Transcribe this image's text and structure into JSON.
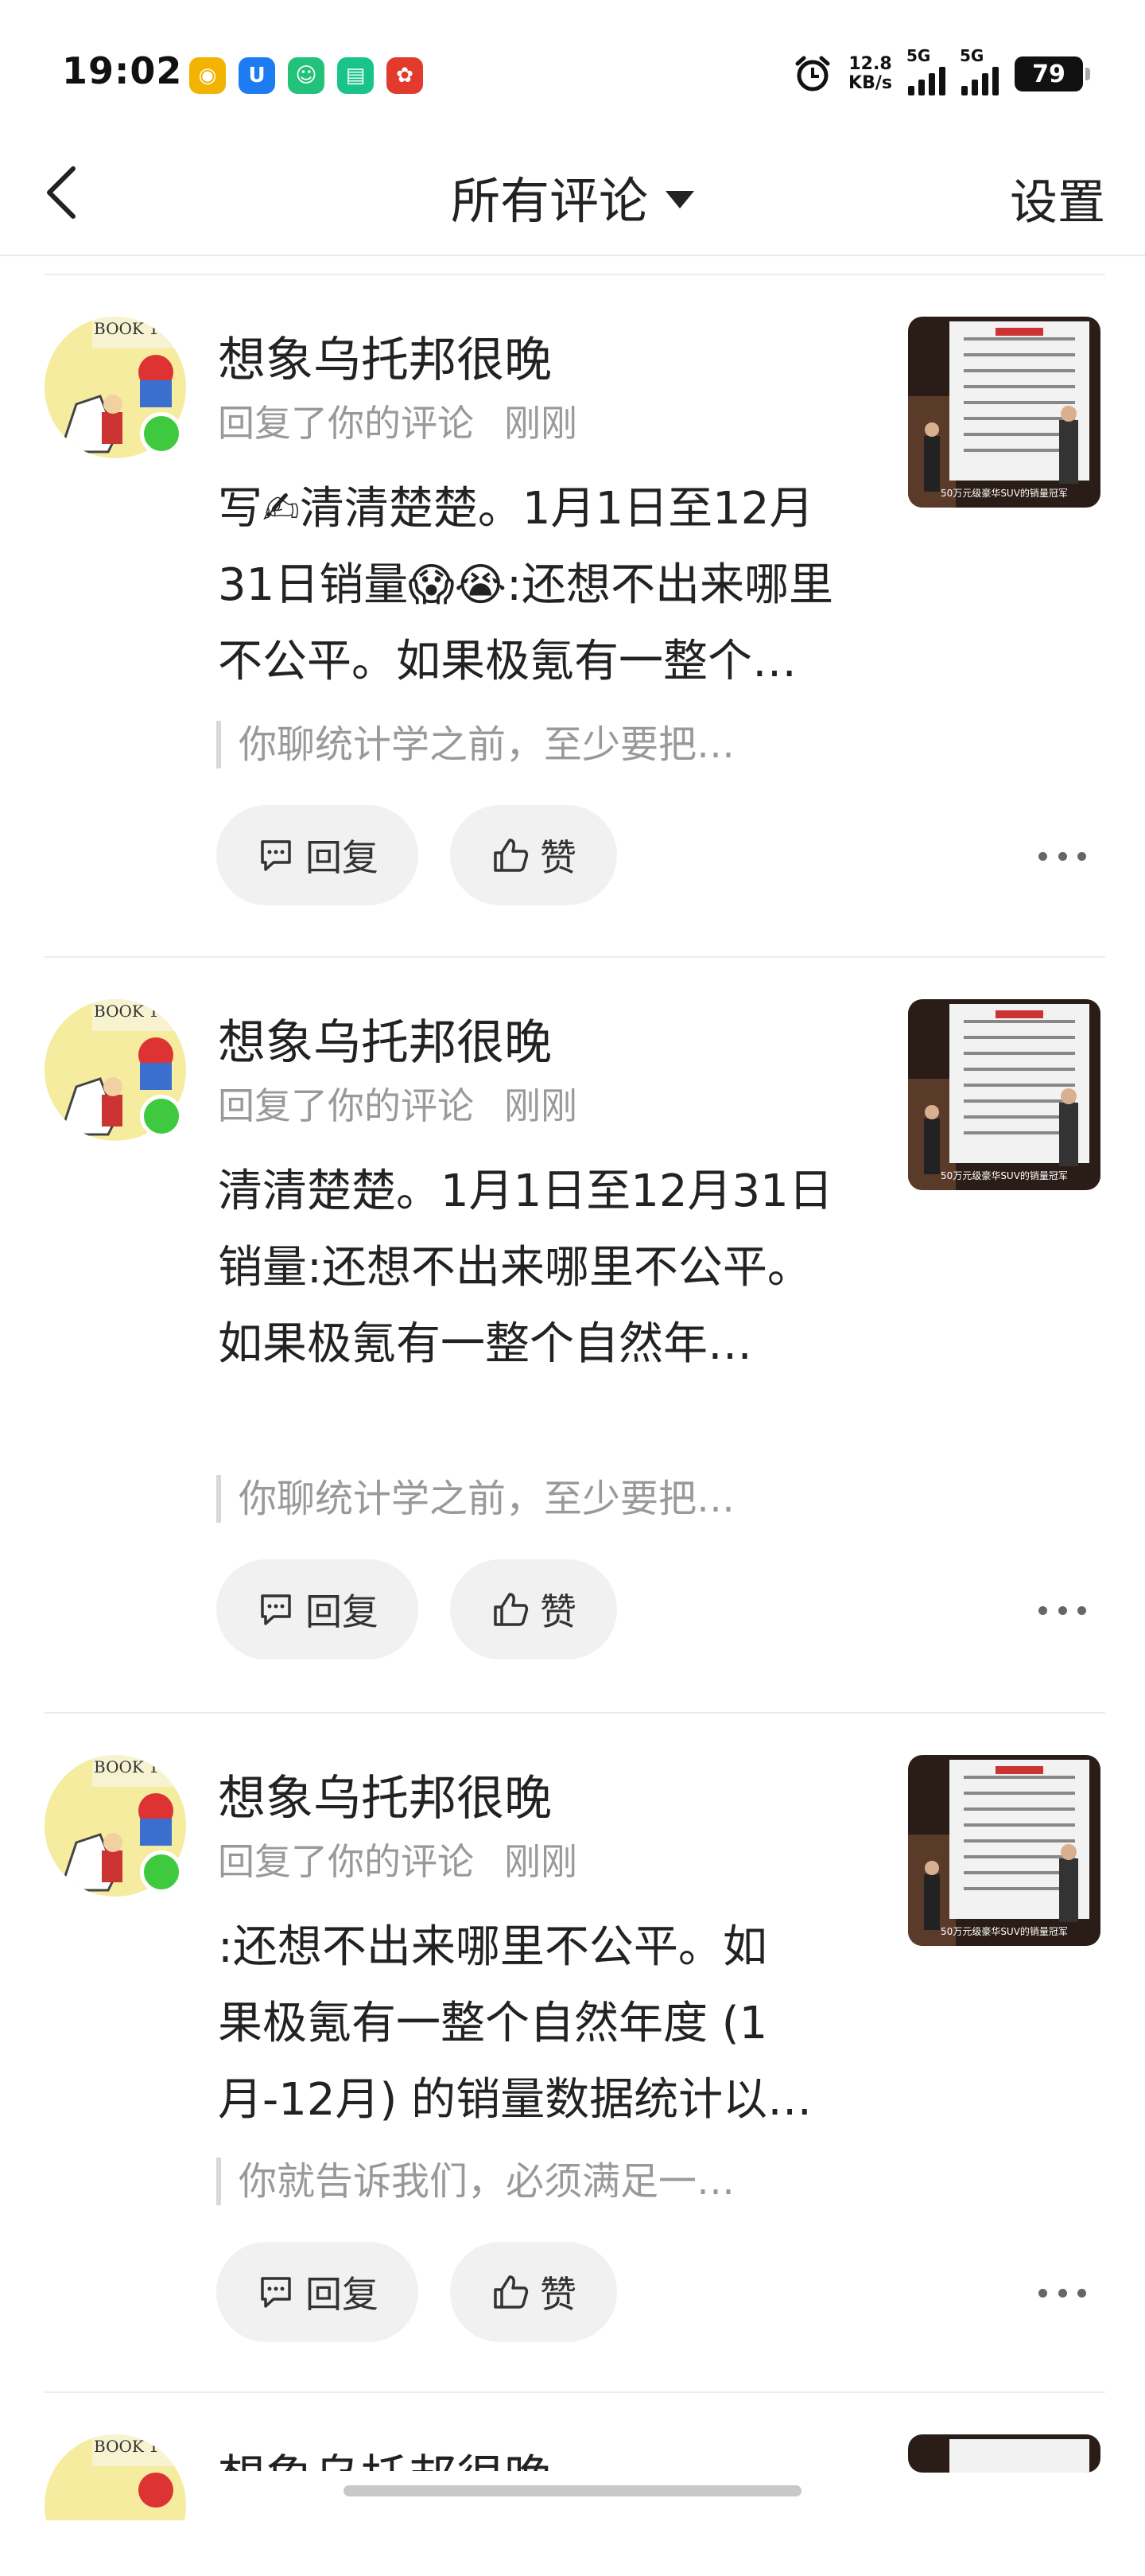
{
  "status": {
    "time": "19:02",
    "speed_value": "12.8",
    "speed_unit": "KB/s",
    "sim1": "5G",
    "sim2": "5G",
    "battery": "79"
  },
  "status_apps": [
    "weibo-icon",
    "app-shield-icon",
    "app-green-icon",
    "chat-icon",
    "red-app-icon"
  ],
  "nav": {
    "title": "所有评论",
    "settings": "设置"
  },
  "cards": [
    {
      "user": "想象乌托邦很晚",
      "action": "回复了你的评论",
      "time": "刚刚",
      "text": "写✍️清清楚楚。1月1日至12月31日销量😱😭:还想不出来哪里不公平。如果极氪有一整个…",
      "text_lines": [
        "写✍清清楚楚。1月1日至12月",
        "31日销量😱😭:还想不出来哪里",
        "不公平。如果极氪有一整个…"
      ],
      "quote": "你聊统计学之前，至少要把…",
      "reply": "回复",
      "like": "赞"
    },
    {
      "user": "想象乌托邦很晚",
      "action": "回复了你的评论",
      "time": "刚刚",
      "text_lines": [
        "清清楚楚。1月1日至12月31日",
        "销量:还想不出来哪里不公平。",
        "如果极氪有一整个自然年…"
      ],
      "quote": "你聊统计学之前，至少要把…",
      "reply": "回复",
      "like": "赞"
    },
    {
      "user": "想象乌托邦很晚",
      "action": "回复了你的评论",
      "time": "刚刚",
      "text_lines": [
        ":还想不出来哪里不公平。如",
        "果极氪有一整个自然年度 (1",
        "月-12月) 的销量数据统计以…"
      ],
      "quote": "你就告诉我们，必须满足一…",
      "reply": "回复",
      "like": "赞"
    },
    {
      "user": "想象乌托邦很晚"
    }
  ],
  "thumb_caption": "50万元级豪华SUV的销量冠军"
}
